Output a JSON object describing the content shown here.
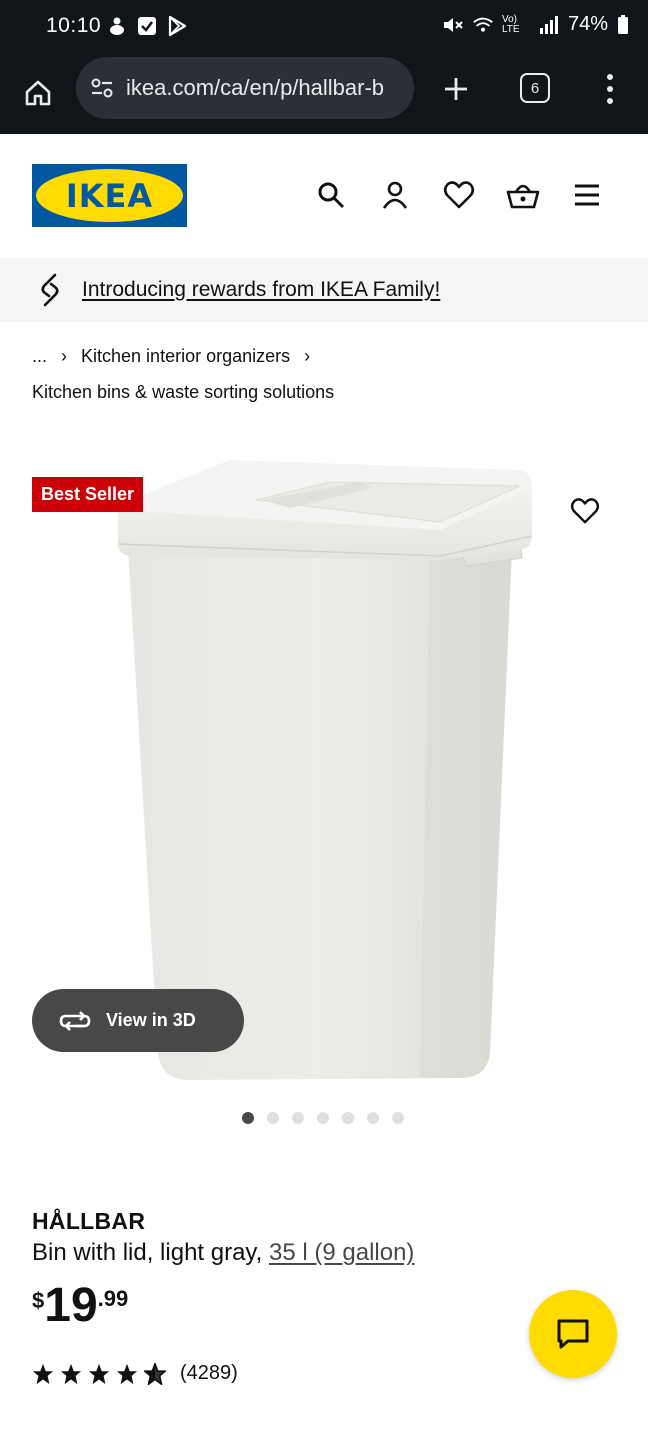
{
  "status_bar": {
    "time": "10:10",
    "battery": "74%",
    "volte_label": "Vo) LTE"
  },
  "browser": {
    "url": "ikea.com/ca/en/p/hallbar-b",
    "tab_count": "6"
  },
  "header": {
    "logo_text": "IKEA",
    "icons": [
      "search-icon",
      "account-icon",
      "favourites-icon",
      "basket-icon",
      "hamburger-menu-icon"
    ]
  },
  "rewards_banner": {
    "text": "Introducing rewards from IKEA Family!"
  },
  "breadcrumb": {
    "ellipsis": "...",
    "separator": "›",
    "parent": "Kitchen interior organizers",
    "current": "Kitchen bins & waste sorting solutions"
  },
  "media": {
    "badge": "Best Seller",
    "view3d_label": "View in 3D",
    "dot_count": 7,
    "active_dot": 0
  },
  "product": {
    "name": "HÅLLBAR",
    "description": "Bin with lid, light gray, ",
    "size_link": "35 l (9 gallon)",
    "price_currency": "$",
    "price_integer": "19",
    "price_decimal": ".99",
    "rating_stars": 4.5,
    "rating_count": "(4289)"
  },
  "colors": {
    "ikea_blue": "#0058a3",
    "ikea_yellow": "#ffdb00",
    "badge_red": "#cc0008",
    "dark_bar": "#111418"
  }
}
